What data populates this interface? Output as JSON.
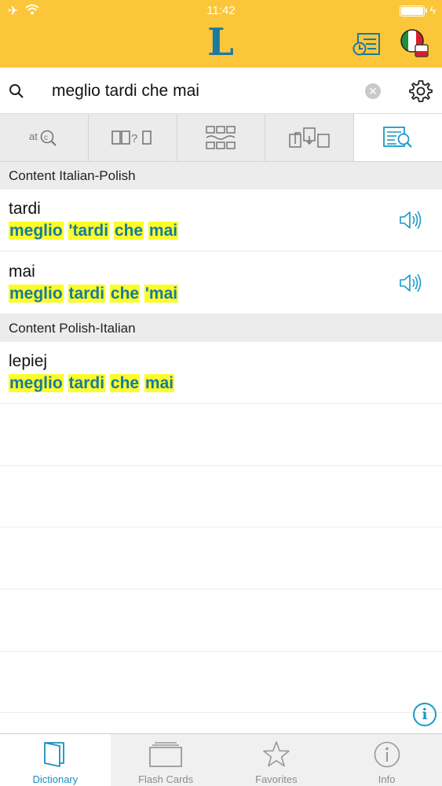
{
  "status_bar": {
    "time": "11:42"
  },
  "search": {
    "query": "meglio tardi che mai"
  },
  "sections": [
    {
      "title": "Content Italian-Polish",
      "entries": [
        {
          "headword": "tardi",
          "phrase": [
            "meglio",
            "'tardi",
            "che",
            "mai"
          ]
        },
        {
          "headword": "mai",
          "phrase": [
            "meglio",
            "tardi",
            "che",
            "'mai"
          ]
        }
      ]
    },
    {
      "title": "Content Polish-Italian",
      "entries": [
        {
          "headword": "lepiej",
          "phrase": [
            "meglio",
            "tardi",
            "che",
            "mai"
          ]
        }
      ]
    }
  ],
  "tabbar": {
    "items": [
      {
        "label": "Dictionary",
        "icon": "book-icon",
        "active": true
      },
      {
        "label": "Flash Cards",
        "icon": "cards-icon",
        "active": false
      },
      {
        "label": "Favorites",
        "icon": "star-icon",
        "active": false
      },
      {
        "label": "Info",
        "icon": "info-icon",
        "active": false
      }
    ]
  },
  "colors": {
    "header": "#fcc63a",
    "accent": "#1a8fbf",
    "phrase": "#167b9e",
    "highlight": "#fcfc2a"
  }
}
